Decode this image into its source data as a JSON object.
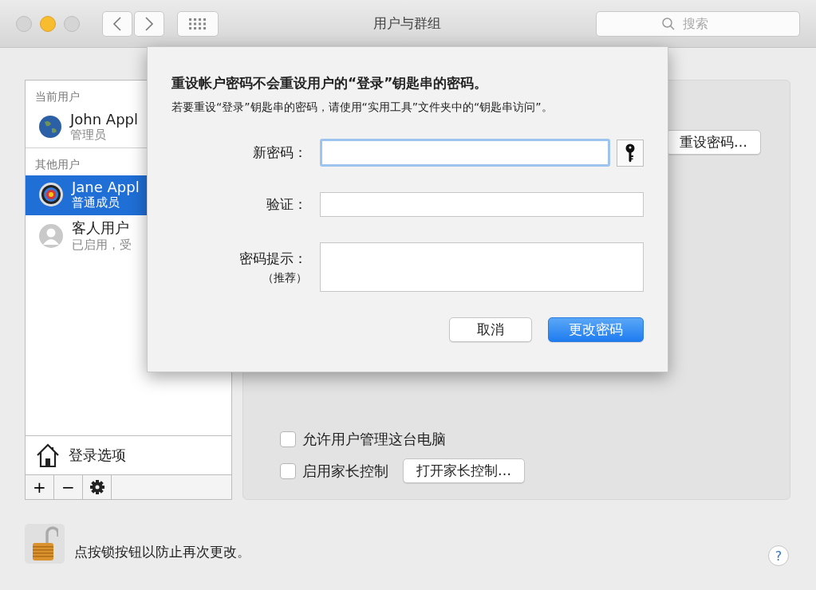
{
  "window": {
    "title": "用户与群组"
  },
  "search": {
    "placeholder": "搜索"
  },
  "sidebar": {
    "sections": [
      {
        "header": "当前用户",
        "users": [
          {
            "name": "John Appl",
            "role": "管理员",
            "kind": "globe",
            "selected": false
          }
        ]
      },
      {
        "header": "其他用户",
        "users": [
          {
            "name": "Jane Appl",
            "role": "普通成员",
            "kind": "target",
            "selected": true
          },
          {
            "name": "客人用户",
            "role": "已启用，受",
            "kind": "person",
            "selected": false
          }
        ]
      }
    ],
    "login_options": "登录选项",
    "toolbar": [
      "+",
      "−"
    ]
  },
  "panel": {
    "reset_button": "重设密码…",
    "checkboxes": [
      {
        "label": "允许用户管理这台电脑",
        "checked": false
      },
      {
        "label": "启用家长控制",
        "checked": false,
        "button": "打开家长控制…"
      }
    ]
  },
  "lock": {
    "text": "点按锁按钮以防止再次更改。",
    "locked": false
  },
  "help": "?",
  "sheet": {
    "title": "重设帐户密码不会重设用户的“登录”钥匙串的密码。",
    "message": "若要重设“登录”钥匙串的密码，请使用“实用工具”文件夹中的“钥匙串访问”。",
    "fields": [
      {
        "label": "新密码：",
        "kind": "password",
        "focused": true
      },
      {
        "label": "验证：",
        "kind": "text",
        "focused": false
      },
      {
        "label": "密码提示：",
        "sublabel": "（推荐）",
        "kind": "textarea",
        "focused": false
      }
    ],
    "buttons": [
      {
        "label": "取消",
        "default": false
      },
      {
        "label": "更改密码",
        "default": true
      }
    ]
  }
}
